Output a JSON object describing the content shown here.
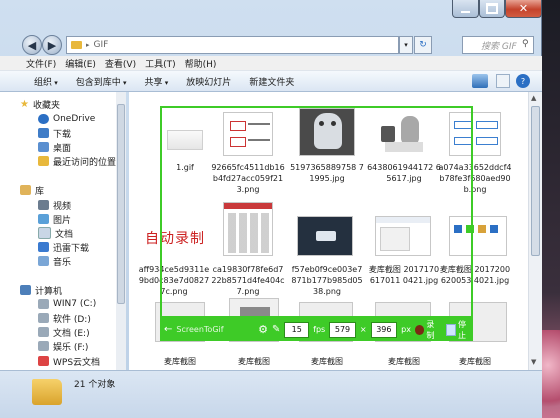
{
  "address": {
    "path": "GIF",
    "search_placeholder": "搜索 GIF"
  },
  "menu": [
    "文件(F)",
    "编辑(E)",
    "查看(V)",
    "工具(T)",
    "帮助(H)"
  ],
  "toolbar": {
    "organize": "组织",
    "include": "包含到库中",
    "share": "共享",
    "slideshow": "放映幻灯片",
    "new_folder": "新建文件夹"
  },
  "nav": {
    "favorites": "收藏夹",
    "onedrive": "OneDrive",
    "downloads": "下载",
    "desktop": "桌面",
    "recent": "最近访问的位置",
    "library": "库",
    "videos": "视频",
    "pictures": "图片",
    "documents": "文档",
    "thunder": "迅雷下载",
    "music": "音乐",
    "computer": "计算机",
    "win7": "WIN7 (C:)",
    "software": "软件 (D:)",
    "docs_e": "文档 (E:)",
    "ent_f": "娱乐 (F:)",
    "wps": "WPS云文档"
  },
  "files": [
    {
      "name": "1.gif"
    },
    {
      "name": "92665fc4511db16b4fd27acc059f213.png"
    },
    {
      "name": "5197365889758 71995.jpg"
    },
    {
      "name": "6438061944172 65617.jpg"
    },
    {
      "name": "a074a33652ddcf4b78fe3f680aed90b.png"
    },
    {
      "name": "aff934ce5d9311e9bd0c83e7d08277c.png"
    },
    {
      "name": "ca19830f78fe6d722b8571d4fe404c7.png"
    },
    {
      "name": "f57eb0f9ce003e7871b177b985d0538.png"
    },
    {
      "name": "麦库截图 2017170617011 0421.jpg"
    },
    {
      "name": "麦库截图 2017200620053 4021.jpg"
    },
    {
      "name": "麦库截图"
    },
    {
      "name": "麦库截图"
    },
    {
      "name": "麦库截图"
    },
    {
      "name": "麦库截图"
    },
    {
      "name": "麦库截图"
    }
  ],
  "thumb_text": {
    "handwriting": "自动录制"
  },
  "status": {
    "count": "21 个对象"
  },
  "capture": {
    "title": "ScreenToGif",
    "fps": "15",
    "fps_label": "fps",
    "width": "579",
    "height": "396",
    "px_label": "px",
    "record_label": "录制",
    "stop_label": "停止",
    "times": "×"
  },
  "colors": {
    "capture_green": "#3ecb27",
    "folder_yellow": "#e8b83c",
    "accent_blue": "#2b6fc4"
  }
}
